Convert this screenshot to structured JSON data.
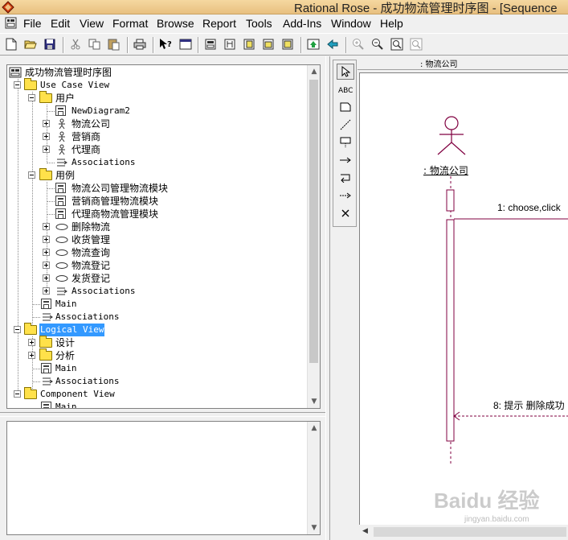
{
  "window": {
    "title": "Rational Rose - 成功物流管理时序图 - [Sequence"
  },
  "menu": {
    "items": [
      "File",
      "Edit",
      "View",
      "Format",
      "Browse",
      "Report",
      "Tools",
      "Add-Ins",
      "Window",
      "Help"
    ]
  },
  "toolbar": {
    "icons": [
      "new-icon",
      "open-icon",
      "save-icon",
      "cut-icon",
      "copy-icon",
      "paste-icon",
      "print-icon",
      "context-help-icon",
      "view-doc-icon",
      "browse-class-icon",
      "browse-interaction-icon",
      "browse-component-icon",
      "browse-deployment-icon",
      "browse-parent-icon",
      "browse-previous-icon",
      "zoom-in-icon",
      "zoom-out-icon",
      "fit-window-icon",
      "undo-fit-icon"
    ]
  },
  "browser": {
    "rows": [
      {
        "label": "成功物流管理时序图",
        "icon": "model-icon"
      },
      {
        "label": "Use Case View",
        "icon": "folder-icon"
      },
      {
        "label": "用户",
        "icon": "folder-icon"
      },
      {
        "label": "NewDiagram2",
        "icon": "diagram-icon"
      },
      {
        "label": "物流公司",
        "icon": "actor-icon"
      },
      {
        "label": "营销商",
        "icon": "actor-icon"
      },
      {
        "label": "代理商",
        "icon": "actor-icon"
      },
      {
        "label": "Associations",
        "icon": "associations-icon"
      },
      {
        "label": "用例",
        "icon": "folder-icon"
      },
      {
        "label": "物流公司管理物流模块",
        "icon": "diagram-icon"
      },
      {
        "label": "营销商管理物流模块",
        "icon": "diagram-icon"
      },
      {
        "label": "代理商物流管理模块",
        "icon": "diagram-icon"
      },
      {
        "label": "删除物流",
        "icon": "usecase-icon"
      },
      {
        "label": "收货管理",
        "icon": "usecase-icon"
      },
      {
        "label": "物流查询",
        "icon": "usecase-icon"
      },
      {
        "label": "物流登记",
        "icon": "usecase-icon"
      },
      {
        "label": "发货登记",
        "icon": "usecase-icon"
      },
      {
        "label": "Associations",
        "icon": "associations-icon"
      },
      {
        "label": "Main",
        "icon": "diagram-icon"
      },
      {
        "label": "Associations",
        "icon": "associations-icon"
      },
      {
        "label": "Logical View",
        "icon": "folder-icon"
      },
      {
        "label": "设计",
        "icon": "folder-icon"
      },
      {
        "label": "分析",
        "icon": "folder-icon"
      },
      {
        "label": "Main",
        "icon": "diagram-icon"
      },
      {
        "label": "Associations",
        "icon": "associations-icon"
      },
      {
        "label": "Component View",
        "icon": "folder-icon"
      },
      {
        "label": "Main",
        "icon": "diagram-icon"
      }
    ]
  },
  "diagram": {
    "header_object": ": 物流公司",
    "actor_label": ": 物流公司",
    "messages": [
      {
        "label": "1: choose,click"
      },
      {
        "label": "8: 提示 删除成功"
      }
    ]
  },
  "watermark": {
    "text": "Baidu 经验",
    "sub": "jingyan.baidu.com"
  },
  "colors": {
    "selection": "#3399ff",
    "lifeline": "#800040",
    "folder": "#ffe14a"
  }
}
